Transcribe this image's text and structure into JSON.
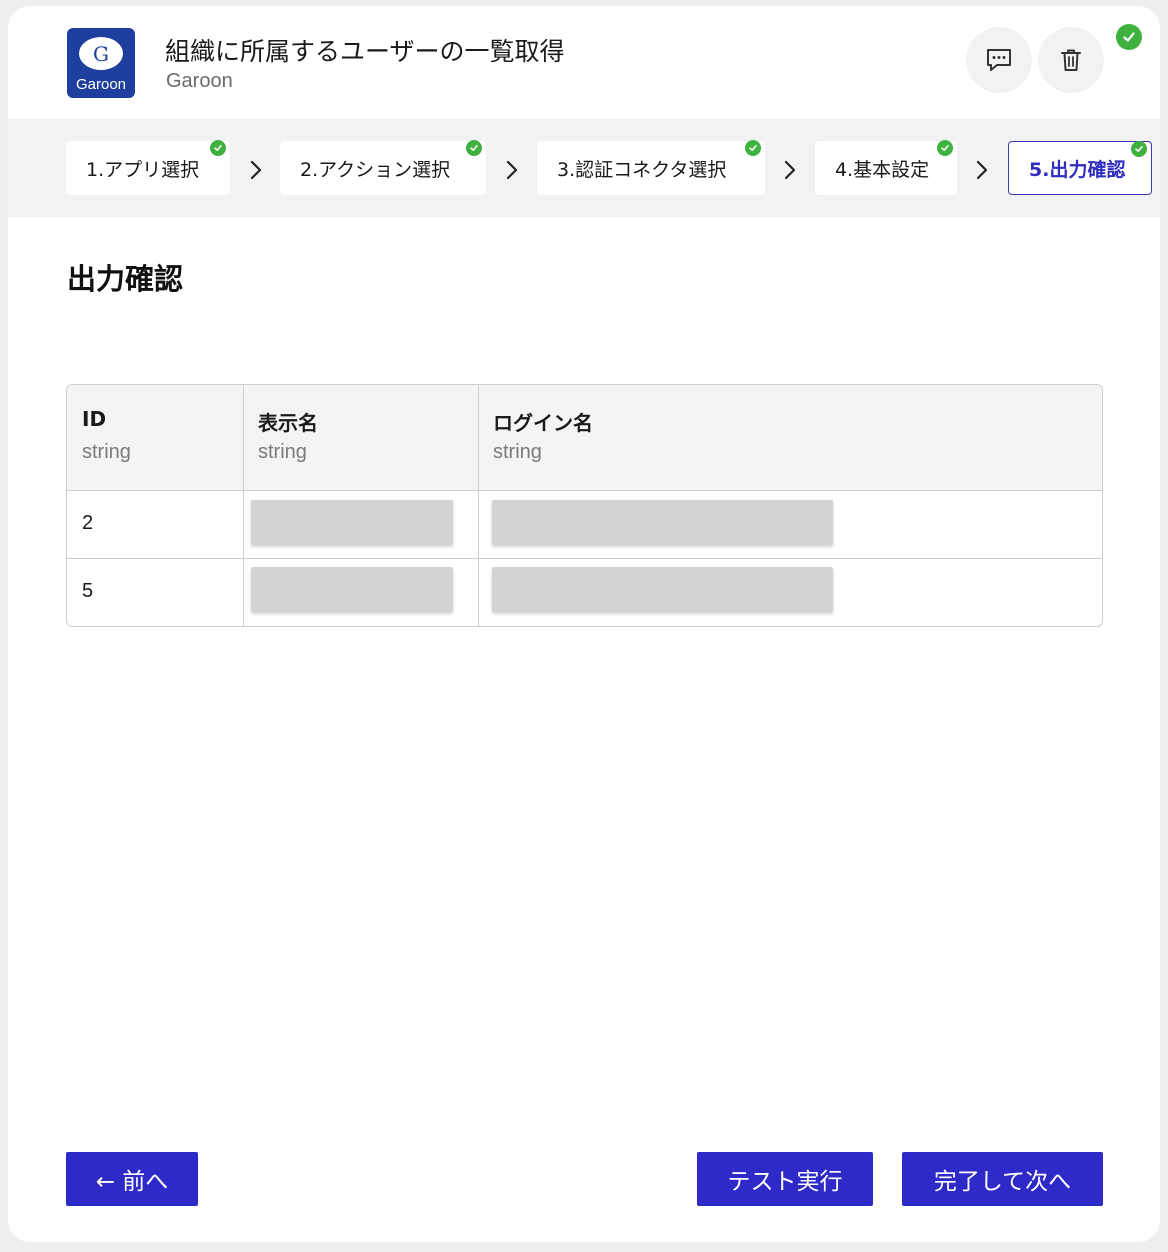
{
  "header": {
    "app_logo_letter": "G",
    "app_logo_text": "Garoon",
    "title": "組織に所属するユーザーの一覧取得",
    "subtitle": "Garoon",
    "comment_icon": "comment-icon",
    "delete_icon": "trash-icon",
    "status_icon": "check-circle-icon"
  },
  "steps": [
    {
      "label": "1.アプリ選択",
      "completed": true
    },
    {
      "label": "2.アクション選択",
      "completed": true
    },
    {
      "label": "3.認証コネクタ選択",
      "completed": true
    },
    {
      "label": "4.基本設定",
      "completed": true
    },
    {
      "label": "5.出力確認",
      "completed": true,
      "active": true
    }
  ],
  "section": {
    "title": "出力確認"
  },
  "table": {
    "columns": [
      {
        "name": "ID",
        "type": "string"
      },
      {
        "name": "表示名",
        "type": "string"
      },
      {
        "name": "ログイン名",
        "type": "string"
      }
    ],
    "rows": [
      {
        "id": "2",
        "display_name": "",
        "login_name": ""
      },
      {
        "id": "5",
        "display_name": "",
        "login_name": ""
      }
    ]
  },
  "footer": {
    "prev_label": "← 前へ",
    "test_label": "テスト実行",
    "next_label": "完了して次へ"
  },
  "colors": {
    "accent": "#2e2ac8",
    "success": "#3fb13f",
    "logo_bg": "#1f3f9e"
  }
}
